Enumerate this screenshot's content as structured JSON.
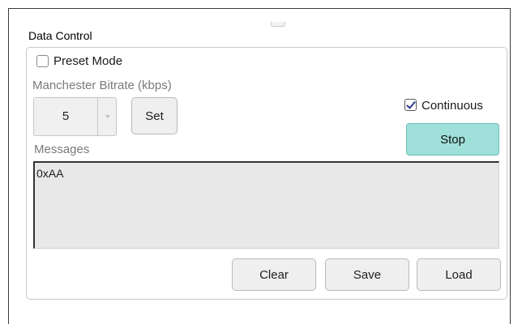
{
  "panel": {
    "title": "Data Control"
  },
  "preset_mode": {
    "label": "Preset Mode",
    "checked": false
  },
  "bitrate": {
    "label": "Manchester Bitrate (kbps)",
    "selected_value": "5",
    "set_label": "Set"
  },
  "continuous": {
    "label": "Continuous",
    "checked": true
  },
  "stop": {
    "label": "Stop",
    "color": "#9fe0da"
  },
  "messages": {
    "label": "Messages",
    "lines": [
      "0xAA"
    ]
  },
  "actions": {
    "clear_label": "Clear",
    "save_label": "Save",
    "load_label": "Load"
  }
}
